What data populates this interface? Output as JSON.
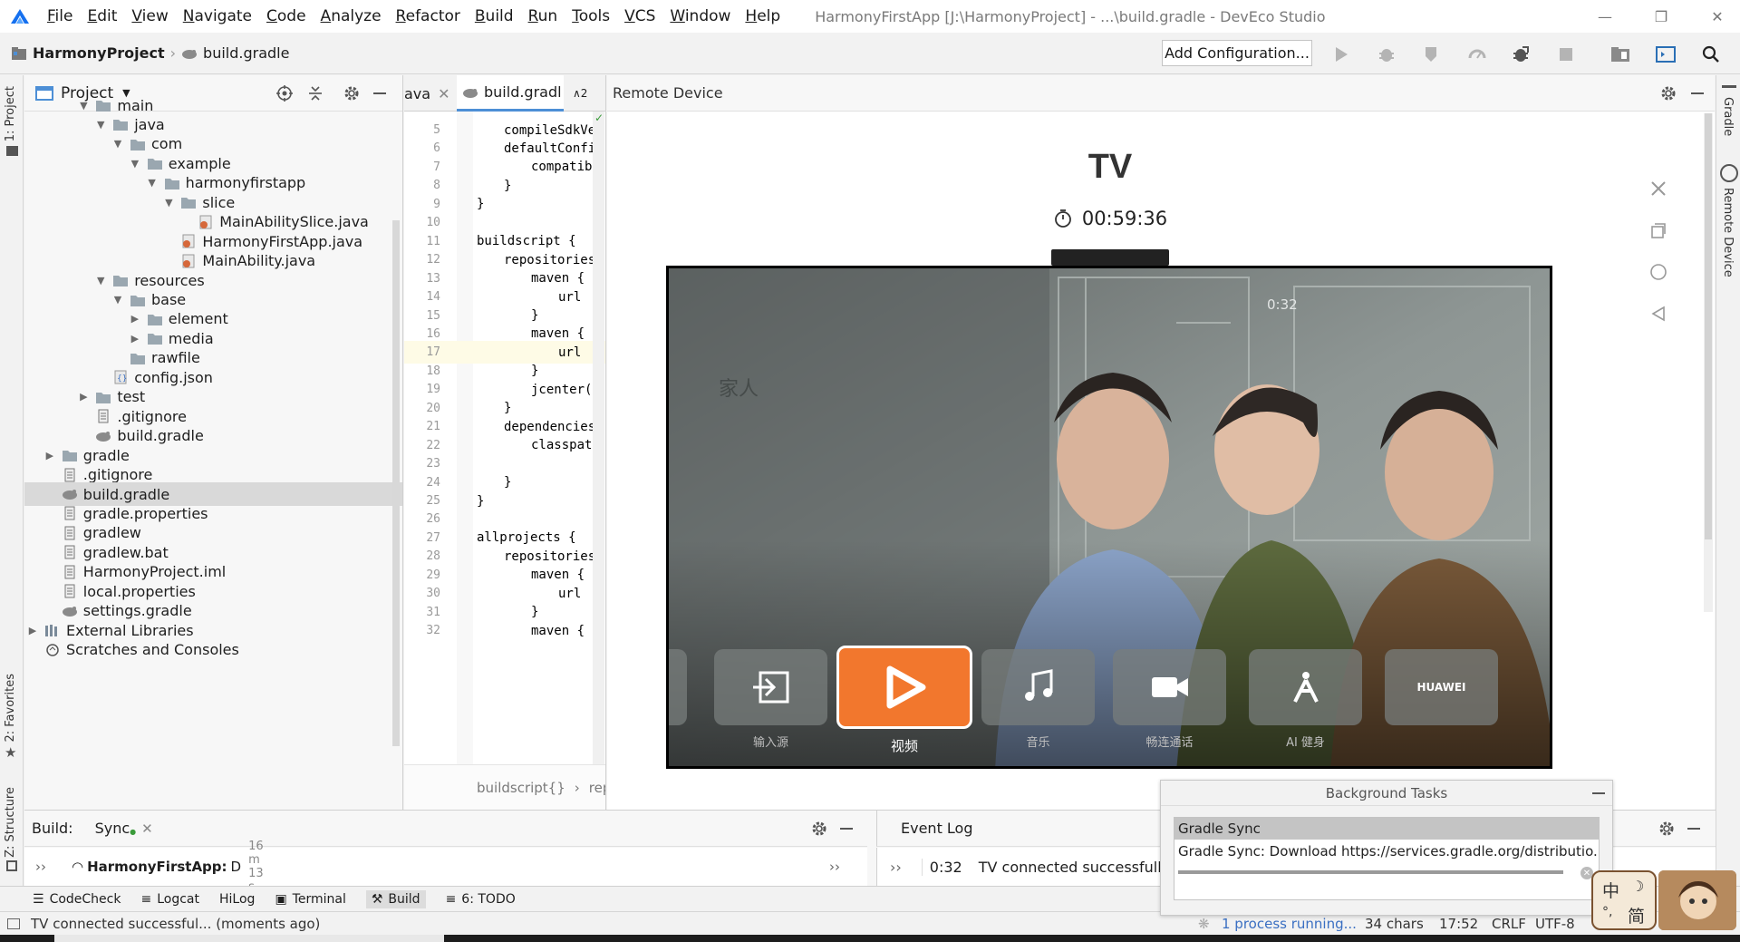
{
  "menubar": {
    "items": [
      "File",
      "Edit",
      "View",
      "Navigate",
      "Code",
      "Analyze",
      "Refactor",
      "Build",
      "Run",
      "Tools",
      "VCS",
      "Window",
      "Help"
    ],
    "window_title": "HarmonyFirstApp [J:\\HarmonyProject] - ...\\build.gradle - DevEco Studio"
  },
  "navbar": {
    "project": "HarmonyProject",
    "file": "build.gradle",
    "add_config": "Add Configuration..."
  },
  "left_stripe": {
    "project": "1: Project",
    "favorites": "2: Favorites",
    "structure": "Z: Structure"
  },
  "right_stripe": {
    "gradle": "Gradle",
    "remote_device": "Remote Device"
  },
  "project_panel": {
    "title": "Project",
    "tree": [
      {
        "label": "main",
        "depth": 3,
        "type": "folder",
        "twisty": "open"
      },
      {
        "label": "java",
        "depth": 4,
        "type": "folder",
        "twisty": "open"
      },
      {
        "label": "com",
        "depth": 5,
        "type": "folder",
        "twisty": "open"
      },
      {
        "label": "example",
        "depth": 6,
        "type": "folder",
        "twisty": "open"
      },
      {
        "label": "harmonyfirstapp",
        "depth": 7,
        "type": "folder",
        "twisty": "open"
      },
      {
        "label": "slice",
        "depth": 8,
        "type": "folder",
        "twisty": "open"
      },
      {
        "label": "MainAbilitySlice.java",
        "depth": 9,
        "type": "java",
        "twisty": ""
      },
      {
        "label": "HarmonyFirstApp.java",
        "depth": 8,
        "type": "java",
        "twisty": ""
      },
      {
        "label": "MainAbility.java",
        "depth": 8,
        "type": "java",
        "twisty": ""
      },
      {
        "label": "resources",
        "depth": 4,
        "type": "folder",
        "twisty": "open"
      },
      {
        "label": "base",
        "depth": 5,
        "type": "folder",
        "twisty": "open"
      },
      {
        "label": "element",
        "depth": 6,
        "type": "folder",
        "twisty": "closed"
      },
      {
        "label": "media",
        "depth": 6,
        "type": "folder",
        "twisty": "closed"
      },
      {
        "label": "rawfile",
        "depth": 5,
        "type": "folder",
        "twisty": ""
      },
      {
        "label": "config.json",
        "depth": 4,
        "type": "json",
        "twisty": ""
      },
      {
        "label": "test",
        "depth": 3,
        "type": "folder",
        "twisty": "closed"
      },
      {
        "label": ".gitignore",
        "depth": 3,
        "type": "file",
        "twisty": ""
      },
      {
        "label": "build.gradle",
        "depth": 3,
        "type": "gradle",
        "twisty": ""
      },
      {
        "label": "gradle",
        "depth": 1,
        "type": "folder",
        "twisty": "closed"
      },
      {
        "label": ".gitignore",
        "depth": 1,
        "type": "file",
        "twisty": ""
      },
      {
        "label": "build.gradle",
        "depth": 1,
        "type": "gradle",
        "twisty": "",
        "selected": true
      },
      {
        "label": "gradle.properties",
        "depth": 1,
        "type": "file",
        "twisty": ""
      },
      {
        "label": "gradlew",
        "depth": 1,
        "type": "file",
        "twisty": ""
      },
      {
        "label": "gradlew.bat",
        "depth": 1,
        "type": "file",
        "twisty": ""
      },
      {
        "label": "HarmonyProject.iml",
        "depth": 1,
        "type": "file",
        "twisty": ""
      },
      {
        "label": "local.properties",
        "depth": 1,
        "type": "file",
        "twisty": ""
      },
      {
        "label": "settings.gradle",
        "depth": 1,
        "type": "gradle",
        "twisty": ""
      },
      {
        "label": "External Libraries",
        "depth": 0,
        "type": "lib",
        "twisty": "closed"
      },
      {
        "label": "Scratches and Consoles",
        "depth": 0,
        "type": "scratch",
        "twisty": ""
      }
    ]
  },
  "editor": {
    "tabs": [
      "ava",
      "build.gradl",
      "∧2"
    ],
    "lines": [
      {
        "n": "5",
        "text": "compileSdkVe",
        "indent": 1
      },
      {
        "n": "6",
        "text": "defaultConfi",
        "indent": 1
      },
      {
        "n": "7",
        "text": "compatib",
        "indent": 2
      },
      {
        "n": "8",
        "text": "}",
        "indent": 1
      },
      {
        "n": "9",
        "text": "}",
        "indent": 0
      },
      {
        "n": "10",
        "text": "",
        "indent": 0
      },
      {
        "n": "11",
        "text": "buildscript {",
        "indent": 0
      },
      {
        "n": "12",
        "text": "repositories",
        "indent": 1
      },
      {
        "n": "13",
        "text": "maven {",
        "indent": 2
      },
      {
        "n": "14",
        "text": "url",
        "indent": 3
      },
      {
        "n": "15",
        "text": "}",
        "indent": 2
      },
      {
        "n": "16",
        "text": "maven {",
        "indent": 2
      },
      {
        "n": "17",
        "text": "url",
        "indent": 3,
        "hl": true
      },
      {
        "n": "18",
        "text": "}",
        "indent": 2
      },
      {
        "n": "19",
        "text": "jcenter(",
        "indent": 2
      },
      {
        "n": "20",
        "text": "}",
        "indent": 1
      },
      {
        "n": "21",
        "text": "dependencies",
        "indent": 1
      },
      {
        "n": "22",
        "text": "classpat",
        "indent": 2
      },
      {
        "n": "23",
        "text": "",
        "indent": 0
      },
      {
        "n": "24",
        "text": "}",
        "indent": 1
      },
      {
        "n": "25",
        "text": "}",
        "indent": 0
      },
      {
        "n": "26",
        "text": "",
        "indent": 0
      },
      {
        "n": "27",
        "text": "allprojects {",
        "indent": 0
      },
      {
        "n": "28",
        "text": "repositories",
        "indent": 1
      },
      {
        "n": "29",
        "text": "maven {",
        "indent": 2
      },
      {
        "n": "30",
        "text": "url",
        "indent": 3
      },
      {
        "n": "31",
        "text": "}",
        "indent": 2
      },
      {
        "n": "32",
        "text": "maven {",
        "indent": 2
      }
    ],
    "breadcrumb": [
      "buildscript{}",
      "rep"
    ]
  },
  "remote_device": {
    "header": "Remote Device",
    "device_name": "TV",
    "timer": "00:59:36",
    "apps": [
      {
        "label": "",
        "icon": "partial-tile"
      },
      {
        "label": "输入源",
        "icon": "input-source-icon"
      },
      {
        "label": "视频",
        "icon": "video-play-icon",
        "active": true
      },
      {
        "label": "音乐",
        "icon": "music-note-icon"
      },
      {
        "label": "畅连通话",
        "icon": "video-call-icon"
      },
      {
        "label": "AI 健身",
        "icon": "fitness-icon"
      },
      {
        "label": "",
        "icon": "huawei-tile",
        "tile_text": "HUAWEI"
      }
    ],
    "screen_text": [
      "0:32",
      "家人"
    ]
  },
  "bg_tasks": {
    "title": "Background Tasks",
    "task": "Gradle Sync",
    "desc": "Gradle Sync: Download https://services.gradle.org/distributio..."
  },
  "build_panel": {
    "label": "Build:",
    "tab": "Sync",
    "row_title": "HarmonyFirstApp:",
    "row_suffix": "D",
    "row_time": "16 m 13 s"
  },
  "event_log": {
    "title": "Event Log",
    "time": "0:32",
    "message": "TV connected successfully."
  },
  "toolstrip": {
    "items": [
      "CodeCheck",
      "Logcat",
      "HiLog",
      "Terminal",
      "Build",
      "6: TODO"
    ]
  },
  "statusbar": {
    "message": "TV connected successful... (moments ago)",
    "process": "1 process running...",
    "chars": "34 chars",
    "position": "17:52",
    "line_sep": "CRLF",
    "encoding": "UTF-8"
  },
  "ime": {
    "top": "中",
    "bottom": "简"
  },
  "colors": {
    "accent_orange": "#f2772d",
    "selection": "#d9d9d9",
    "highlight_line": "#fefbe6",
    "logo_blue": "#1570ef"
  }
}
